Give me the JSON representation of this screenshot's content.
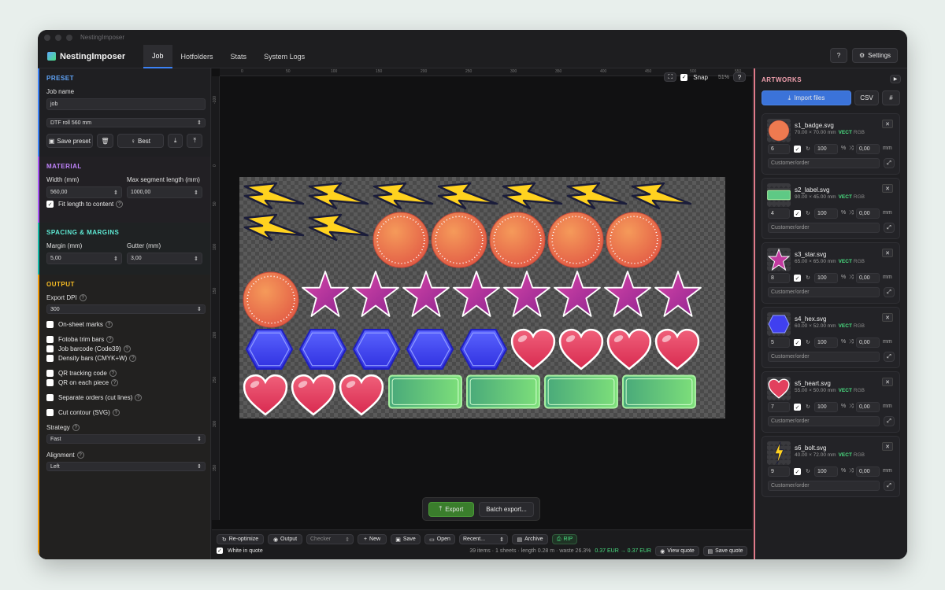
{
  "window": {
    "title": "NestingImposer"
  },
  "app": {
    "name": "NestingImposer"
  },
  "tabs": [
    {
      "label": "Job"
    },
    {
      "label": "Hotfolders"
    },
    {
      "label": "Stats"
    },
    {
      "label": "System Logs"
    }
  ],
  "header": {
    "settings_label": "Settings"
  },
  "preset": {
    "title": "PRESET",
    "job_name_label": "Job name",
    "job_name_value": "job",
    "roll_value": "DTF roll 560 mm",
    "save_preset_label": "Save preset",
    "best_label": "Best"
  },
  "material": {
    "title": "MATERIAL",
    "width_label": "Width (mm)",
    "width_value": "560,00",
    "max_seg_label": "Max segment length (mm)",
    "max_seg_value": "1000,00",
    "fit_label": "Fit length to content"
  },
  "spacing": {
    "title": "SPACING & MARGINS",
    "margin_label": "Margin (mm)",
    "margin_value": "5,00",
    "gutter_label": "Gutter (mm)",
    "gutter_value": "3,00"
  },
  "output": {
    "title": "OUTPUT",
    "dpi_label": "Export DPI",
    "dpi_value": "300",
    "onsheet_label": "On-sheet marks",
    "fotoba_label": "Fotoba trim bars",
    "barcode_label": "Job barcode (Code39)",
    "density_label": "Density bars (CMYK+W)",
    "qr_label": "QR tracking code",
    "qr_each_label": "QR on each piece",
    "separate_label": "Separate orders (cut lines)",
    "cut_label": "Cut contour (SVG)",
    "strategy_label": "Strategy",
    "strategy_value": "Fast",
    "alignment_label": "Alignment",
    "alignment_value": "Left"
  },
  "canvas": {
    "snap_label": "Snap",
    "zoom": "51%",
    "ruler_x": [
      "0",
      "50",
      "100",
      "150",
      "200",
      "250",
      "300",
      "350",
      "400",
      "450",
      "500",
      "550"
    ],
    "ruler_y": [
      "-100",
      "0",
      "50",
      "100",
      "150",
      "200",
      "250",
      "300",
      "350"
    ]
  },
  "export": {
    "export_label": "Export",
    "batch_label": "Batch export..."
  },
  "toolbar": {
    "reoptimize": "Re-optimize",
    "output": "Output",
    "checker": "Checker",
    "new": "New",
    "save": "Save",
    "open": "Open",
    "recent": "Recent...",
    "archive": "Archive",
    "rip": "RIP"
  },
  "status": {
    "white_in_quote": "White in quote",
    "summary": "39 items · 1 sheets · length 0.28 m · waste 26.3%",
    "price": "0.37 EUR → 0.37 EUR",
    "view_quote": "View quote",
    "save_quote": "Save quote"
  },
  "artworks": {
    "title": "ARTWORKS",
    "import_label": "Import files",
    "csv_label": "CSV",
    "items": [
      {
        "name": "s1_badge.svg",
        "dims": "70.00 × 70.00 mm",
        "vect": "VECT",
        "color": "RGB",
        "qty": "6",
        "scale": "100",
        "offset": "0,00",
        "customer_placeholder": "Customer/order"
      },
      {
        "name": "s2_label.svg",
        "dims": "90.00 × 45.00 mm",
        "vect": "VECT",
        "color": "RGB",
        "qty": "4",
        "scale": "100",
        "offset": "0,00",
        "customer_placeholder": "Customer/order"
      },
      {
        "name": "s3_star.svg",
        "dims": "65.00 × 65.00 mm",
        "vect": "VECT",
        "color": "RGB",
        "qty": "8",
        "scale": "100",
        "offset": "0,00",
        "customer_placeholder": "Customer/order"
      },
      {
        "name": "s4_hex.svg",
        "dims": "60.00 × 52.00 mm",
        "vect": "VECT",
        "color": "RGB",
        "qty": "5",
        "scale": "100",
        "offset": "0,00",
        "customer_placeholder": "Customer/order"
      },
      {
        "name": "s5_heart.svg",
        "dims": "55.00 × 50.00 mm",
        "vect": "VECT",
        "color": "RGB",
        "qty": "7",
        "scale": "100",
        "offset": "0,00",
        "customer_placeholder": "Customer/order"
      },
      {
        "name": "s6_bolt.svg",
        "dims": "40.00 × 72.00 mm",
        "vect": "VECT",
        "color": "RGB",
        "qty": "9",
        "scale": "100",
        "offset": "0,00",
        "customer_placeholder": "Customer/order"
      }
    ],
    "pct_unit": "%",
    "mm_unit": "mm"
  }
}
